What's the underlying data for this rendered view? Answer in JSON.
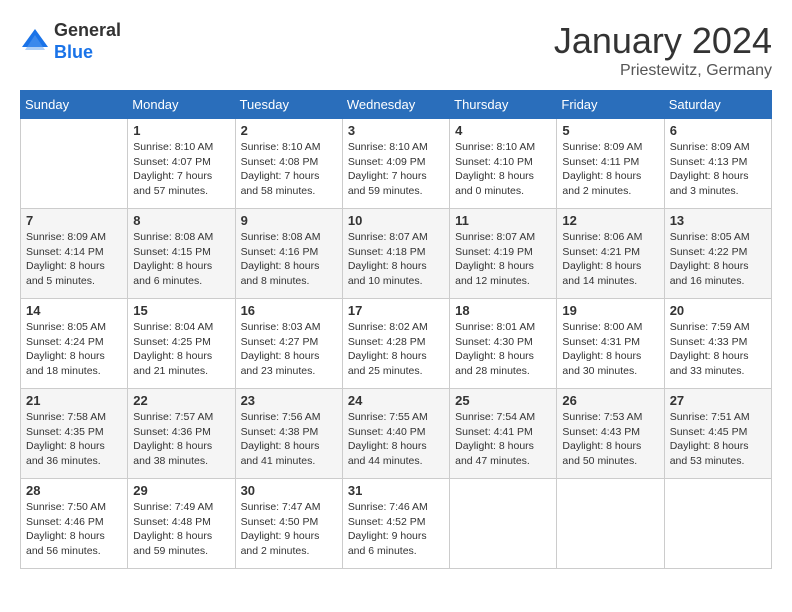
{
  "header": {
    "logo": {
      "general": "General",
      "blue": "Blue"
    },
    "title": "January 2024",
    "subtitle": "Priestewitz, Germany"
  },
  "calendar": {
    "headers": [
      "Sunday",
      "Monday",
      "Tuesday",
      "Wednesday",
      "Thursday",
      "Friday",
      "Saturday"
    ],
    "weeks": [
      [
        {
          "day": "",
          "info": ""
        },
        {
          "day": "1",
          "info": "Sunrise: 8:10 AM\nSunset: 4:07 PM\nDaylight: 7 hours\nand 57 minutes."
        },
        {
          "day": "2",
          "info": "Sunrise: 8:10 AM\nSunset: 4:08 PM\nDaylight: 7 hours\nand 58 minutes."
        },
        {
          "day": "3",
          "info": "Sunrise: 8:10 AM\nSunset: 4:09 PM\nDaylight: 7 hours\nand 59 minutes."
        },
        {
          "day": "4",
          "info": "Sunrise: 8:10 AM\nSunset: 4:10 PM\nDaylight: 8 hours\nand 0 minutes."
        },
        {
          "day": "5",
          "info": "Sunrise: 8:09 AM\nSunset: 4:11 PM\nDaylight: 8 hours\nand 2 minutes."
        },
        {
          "day": "6",
          "info": "Sunrise: 8:09 AM\nSunset: 4:13 PM\nDaylight: 8 hours\nand 3 minutes."
        }
      ],
      [
        {
          "day": "7",
          "info": "Sunrise: 8:09 AM\nSunset: 4:14 PM\nDaylight: 8 hours\nand 5 minutes."
        },
        {
          "day": "8",
          "info": "Sunrise: 8:08 AM\nSunset: 4:15 PM\nDaylight: 8 hours\nand 6 minutes."
        },
        {
          "day": "9",
          "info": "Sunrise: 8:08 AM\nSunset: 4:16 PM\nDaylight: 8 hours\nand 8 minutes."
        },
        {
          "day": "10",
          "info": "Sunrise: 8:07 AM\nSunset: 4:18 PM\nDaylight: 8 hours\nand 10 minutes."
        },
        {
          "day": "11",
          "info": "Sunrise: 8:07 AM\nSunset: 4:19 PM\nDaylight: 8 hours\nand 12 minutes."
        },
        {
          "day": "12",
          "info": "Sunrise: 8:06 AM\nSunset: 4:21 PM\nDaylight: 8 hours\nand 14 minutes."
        },
        {
          "day": "13",
          "info": "Sunrise: 8:05 AM\nSunset: 4:22 PM\nDaylight: 8 hours\nand 16 minutes."
        }
      ],
      [
        {
          "day": "14",
          "info": "Sunrise: 8:05 AM\nSunset: 4:24 PM\nDaylight: 8 hours\nand 18 minutes."
        },
        {
          "day": "15",
          "info": "Sunrise: 8:04 AM\nSunset: 4:25 PM\nDaylight: 8 hours\nand 21 minutes."
        },
        {
          "day": "16",
          "info": "Sunrise: 8:03 AM\nSunset: 4:27 PM\nDaylight: 8 hours\nand 23 minutes."
        },
        {
          "day": "17",
          "info": "Sunrise: 8:02 AM\nSunset: 4:28 PM\nDaylight: 8 hours\nand 25 minutes."
        },
        {
          "day": "18",
          "info": "Sunrise: 8:01 AM\nSunset: 4:30 PM\nDaylight: 8 hours\nand 28 minutes."
        },
        {
          "day": "19",
          "info": "Sunrise: 8:00 AM\nSunset: 4:31 PM\nDaylight: 8 hours\nand 30 minutes."
        },
        {
          "day": "20",
          "info": "Sunrise: 7:59 AM\nSunset: 4:33 PM\nDaylight: 8 hours\nand 33 minutes."
        }
      ],
      [
        {
          "day": "21",
          "info": "Sunrise: 7:58 AM\nSunset: 4:35 PM\nDaylight: 8 hours\nand 36 minutes."
        },
        {
          "day": "22",
          "info": "Sunrise: 7:57 AM\nSunset: 4:36 PM\nDaylight: 8 hours\nand 38 minutes."
        },
        {
          "day": "23",
          "info": "Sunrise: 7:56 AM\nSunset: 4:38 PM\nDaylight: 8 hours\nand 41 minutes."
        },
        {
          "day": "24",
          "info": "Sunrise: 7:55 AM\nSunset: 4:40 PM\nDaylight: 8 hours\nand 44 minutes."
        },
        {
          "day": "25",
          "info": "Sunrise: 7:54 AM\nSunset: 4:41 PM\nDaylight: 8 hours\nand 47 minutes."
        },
        {
          "day": "26",
          "info": "Sunrise: 7:53 AM\nSunset: 4:43 PM\nDaylight: 8 hours\nand 50 minutes."
        },
        {
          "day": "27",
          "info": "Sunrise: 7:51 AM\nSunset: 4:45 PM\nDaylight: 8 hours\nand 53 minutes."
        }
      ],
      [
        {
          "day": "28",
          "info": "Sunrise: 7:50 AM\nSunset: 4:46 PM\nDaylight: 8 hours\nand 56 minutes."
        },
        {
          "day": "29",
          "info": "Sunrise: 7:49 AM\nSunset: 4:48 PM\nDaylight: 8 hours\nand 59 minutes."
        },
        {
          "day": "30",
          "info": "Sunrise: 7:47 AM\nSunset: 4:50 PM\nDaylight: 9 hours\nand 2 minutes."
        },
        {
          "day": "31",
          "info": "Sunrise: 7:46 AM\nSunset: 4:52 PM\nDaylight: 9 hours\nand 6 minutes."
        },
        {
          "day": "",
          "info": ""
        },
        {
          "day": "",
          "info": ""
        },
        {
          "day": "",
          "info": ""
        }
      ]
    ]
  }
}
